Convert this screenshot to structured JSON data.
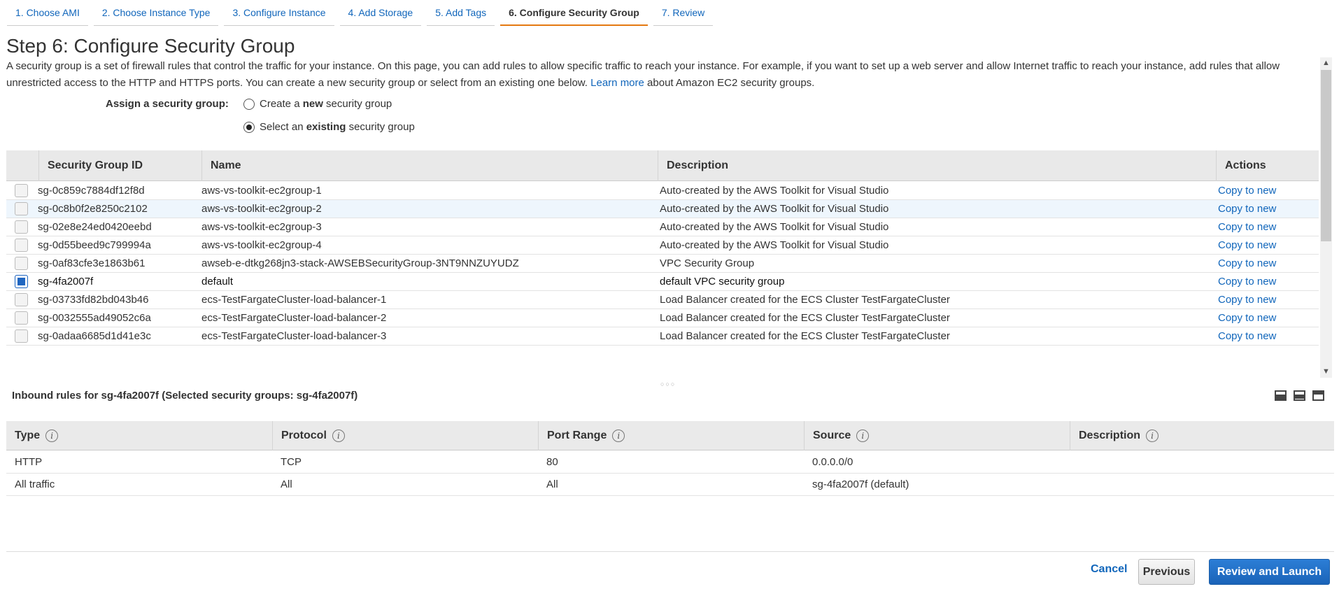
{
  "tabs": [
    {
      "label": "1. Choose AMI"
    },
    {
      "label": "2. Choose Instance Type"
    },
    {
      "label": "3. Configure Instance"
    },
    {
      "label": "4. Add Storage"
    },
    {
      "label": "5. Add Tags"
    },
    {
      "label": "6. Configure Security Group"
    },
    {
      "label": "7. Review"
    }
  ],
  "page": {
    "title": "Step 6: Configure Security Group",
    "intro_text": "A security group is a set of firewall rules that control the traffic for your instance. On this page, you can add rules to allow specific traffic to reach your instance. For example, if you want to set up a web server and allow Internet traffic to reach your instance, add rules that allow unrestricted access to the HTTP and HTTPS ports. You can create a new security group or select from an existing one below.",
    "learn_more": "Learn more",
    "intro_tail": "about Amazon EC2 security groups."
  },
  "assign": {
    "label": "Assign a security group:",
    "option_new_prefix": "Create a ",
    "option_new_bold": "new",
    "option_new_suffix": " security group",
    "option_existing_prefix": "Select an ",
    "option_existing_bold": "existing",
    "option_existing_suffix": " security group",
    "selected": "existing"
  },
  "sg_table": {
    "headers": {
      "id": "Security Group ID",
      "name": "Name",
      "description": "Description",
      "actions": "Actions"
    },
    "rows": [
      {
        "id": "sg-0c859c7884df12f8d",
        "name": "aws-vs-toolkit-ec2group-1",
        "description": "Auto-created by the AWS Toolkit for Visual Studio",
        "action": "Copy to new",
        "checked": false
      },
      {
        "id": "sg-0c8b0f2e8250c2102",
        "name": "aws-vs-toolkit-ec2group-2",
        "description": "Auto-created by the AWS Toolkit for Visual Studio",
        "action": "Copy to new",
        "checked": false
      },
      {
        "id": "sg-02e8e24ed0420eebd",
        "name": "aws-vs-toolkit-ec2group-3",
        "description": "Auto-created by the AWS Toolkit for Visual Studio",
        "action": "Copy to new",
        "checked": false
      },
      {
        "id": "sg-0d55beed9c799994a",
        "name": "aws-vs-toolkit-ec2group-4",
        "description": "Auto-created by the AWS Toolkit for Visual Studio",
        "action": "Copy to new",
        "checked": false
      },
      {
        "id": "sg-0af83cfe3e1863b61",
        "name": "awseb-e-dtkg268jn3-stack-AWSEBSecurityGroup-3NT9NNZUYUDZ",
        "description": "VPC Security Group",
        "action": "Copy to new",
        "checked": false
      },
      {
        "id": "sg-4fa2007f",
        "name": "default",
        "description": "default VPC security group",
        "action": "Copy to new",
        "checked": true
      },
      {
        "id": "sg-03733fd82bd043b46",
        "name": "ecs-TestFargateCluster-load-balancer-1",
        "description": "Load Balancer created for the ECS Cluster TestFargateCluster",
        "action": "Copy to new",
        "checked": false
      },
      {
        "id": "sg-0032555ad49052c6a",
        "name": "ecs-TestFargateCluster-load-balancer-2",
        "description": "Load Balancer created for the ECS Cluster TestFargateCluster",
        "action": "Copy to new",
        "checked": false
      },
      {
        "id": "sg-0adaa6685d1d41e3c",
        "name": "ecs-TestFargateCluster-load-balancer-3",
        "description": "Load Balancer created for the ECS Cluster TestFargateCluster",
        "action": "Copy to new",
        "checked": false
      }
    ]
  },
  "inbound": {
    "title": "Inbound rules for sg-4fa2007f (Selected security groups: sg-4fa2007f)",
    "headers": {
      "type": "Type",
      "protocol": "Protocol",
      "port_range": "Port Range",
      "source": "Source",
      "description": "Description"
    },
    "rows": [
      {
        "type": "HTTP",
        "protocol": "TCP",
        "port_range": "80",
        "source": "0.0.0.0/0",
        "description": ""
      },
      {
        "type": "All traffic",
        "protocol": "All",
        "port_range": "All",
        "source": "sg-4fa2007f (default)",
        "description": ""
      }
    ]
  },
  "footer": {
    "cancel": "Cancel",
    "previous": "Previous",
    "review_launch": "Review and Launch"
  },
  "colors": {
    "link": "#1166bb",
    "accent_tab": "#e47911",
    "primary_button": "#1a63b8"
  }
}
